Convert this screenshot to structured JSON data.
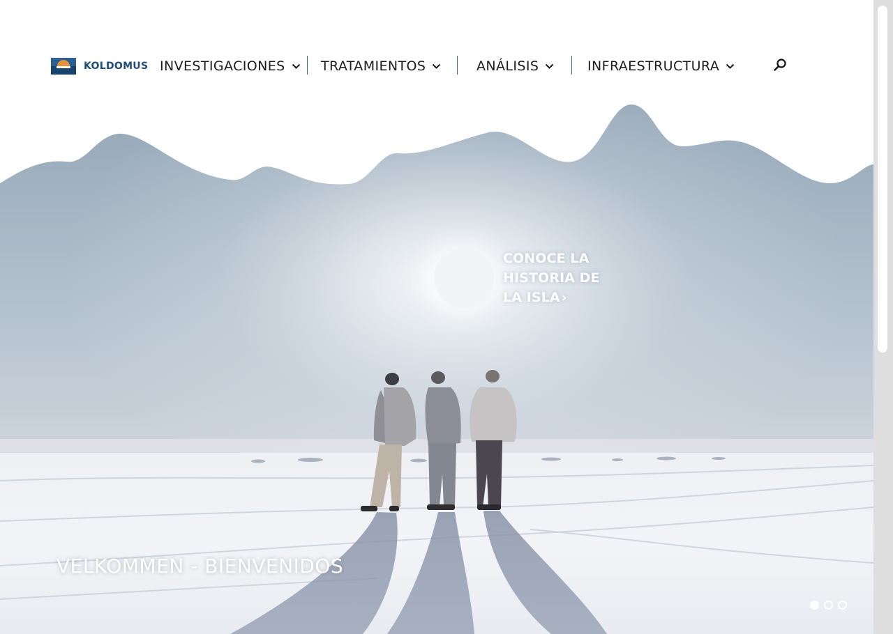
{
  "header": {
    "logo_text": "KOLDOMUS",
    "nav": [
      {
        "label": "INVESTIGACIONES",
        "icon": "chevron-down-icon"
      },
      {
        "label": "TRATAMIENTOS",
        "icon": "chevron-down-icon"
      },
      {
        "label": "ANÁLISIS",
        "icon": "chevron-down-icon"
      },
      {
        "label": "INFRAESTRUCTURA",
        "icon": "chevron-down-icon"
      }
    ],
    "search_icon": "search-icon"
  },
  "hero": {
    "cta_label": "CONOCE LA HISTORIA DE LA ISLA",
    "cta_icon": "chevron-right-icon",
    "welcome": "VELKOMMEN - BIENVENIDOS",
    "slides": {
      "total": 3,
      "active": 1
    }
  },
  "colors": {
    "brand_blue": "#1f4b7c",
    "logo_orange": "#e0953c",
    "divider": "#3d6f9c",
    "nav_text": "#1b1b1b",
    "sky": "#9aaebe",
    "snow": "#eef0f3"
  }
}
